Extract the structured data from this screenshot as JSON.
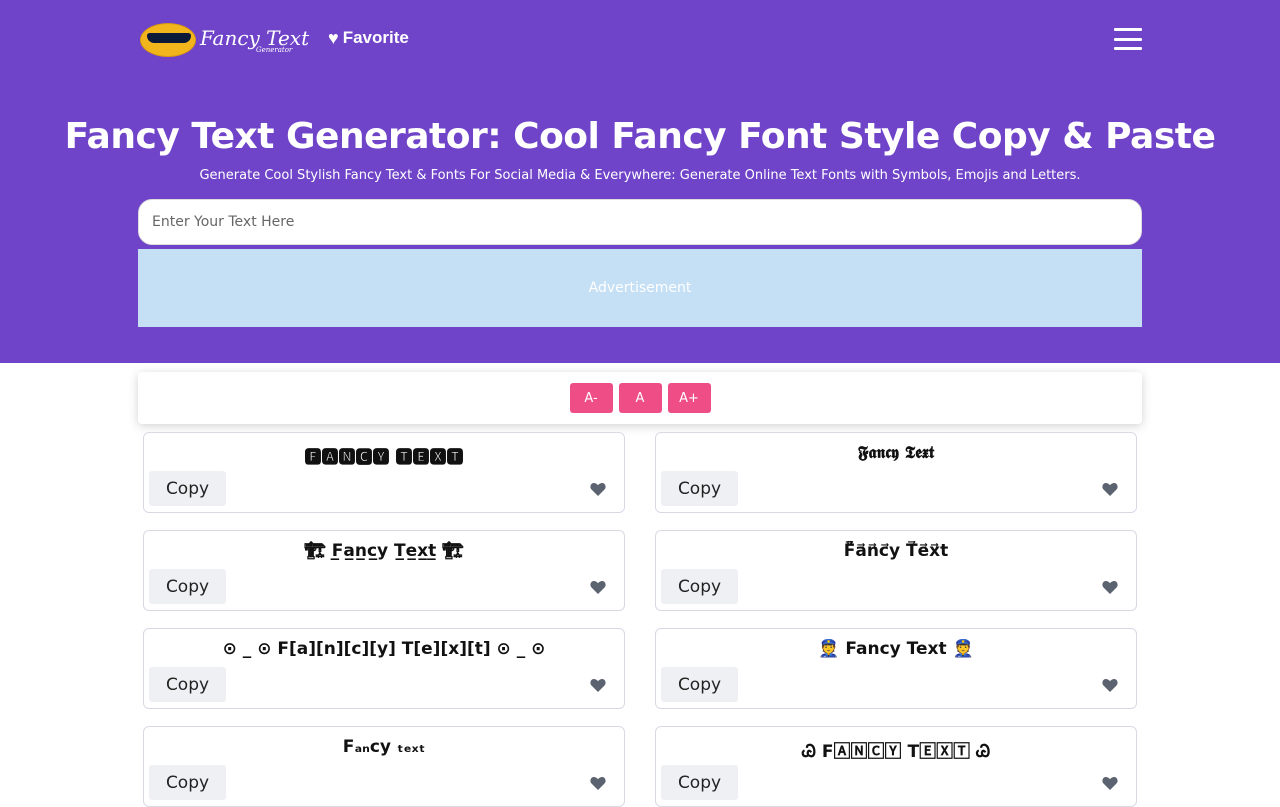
{
  "nav": {
    "logo_text": "Fancy Text",
    "logo_sub": "Generator",
    "favorite_label": "Favorite"
  },
  "hero": {
    "title": "Fancy Text Generator: Cool Fancy Font Style Copy & Paste",
    "subtitle": "Generate Cool Stylish Fancy Text & Fonts For Social Media & Everywhere: Generate Online Text Fonts with Symbols, Emojis and Letters.",
    "input_placeholder": "Enter Your Text Here",
    "ad_label": "Advertisement"
  },
  "size_controls": [
    "A-",
    "A",
    "A+"
  ],
  "cards": [
    {
      "text": "🅵🅰🅽🅲🆈 🆃🅴🆇🆃",
      "copy": "Copy"
    },
    {
      "text": "𝕱𝖆𝖓𝖈𝖞 𝕿𝖊𝖝𝖙",
      "copy": "Copy"
    },
    {
      "text": "🏗 F̲a̲n̲c̲y̲ T̲e̲x̲t̲ 🏗",
      "copy": "Copy"
    },
    {
      "text": "F̊⃗a⃗n⃗c⃗y T⃗e⃗x⃗t",
      "copy": "Copy"
    },
    {
      "text": "⊙ _ ⊙ F[a][n][c][y] T[e][x][t] ⊙ _ ⊙",
      "copy": "Copy"
    },
    {
      "text": "👮 Fancy Text 👮",
      "copy": "Copy"
    },
    {
      "text": "Fₐₙcy ₜₑₓₜ",
      "copy": "Copy"
    },
    {
      "text": "Ꮚ F🄰🄽🄲🅈 T🄴🅇🅃 Ꮚ",
      "copy": "Copy"
    }
  ],
  "colors": {
    "hero_bg": "#6f44c9",
    "accent": "#ee4d85",
    "ad_bg": "#c5dff5"
  }
}
